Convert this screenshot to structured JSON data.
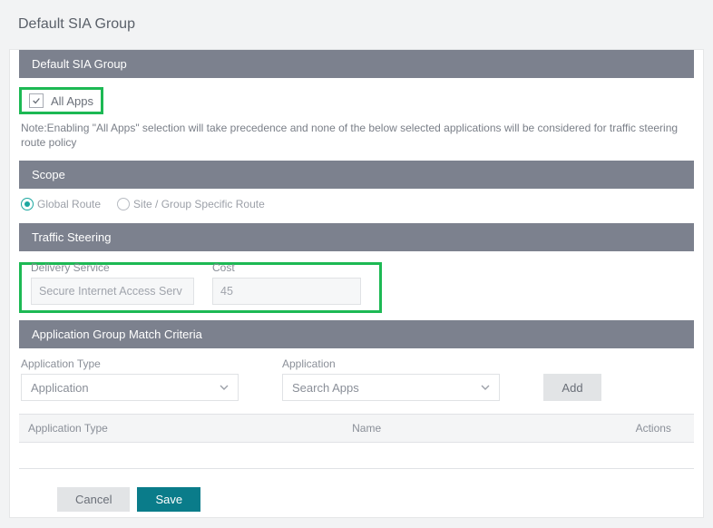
{
  "page_title": "Default SIA Group",
  "bands": {
    "default_sia_group": "Default SIA Group",
    "scope": "Scope",
    "traffic_steering": "Traffic Steering",
    "app_match": "Application Group Match Criteria"
  },
  "all_apps": {
    "label": "All Apps",
    "checked": true
  },
  "note": "Note:Enabling \"All Apps\" selection will take precedence and none of the below selected applications will be considered for traffic steering route policy",
  "scope": {
    "options": [
      {
        "label": "Global Route",
        "selected": true
      },
      {
        "label": "Site / Group Specific Route",
        "selected": false
      }
    ]
  },
  "traffic_steering": {
    "delivery_service": {
      "label": "Delivery Service",
      "value": "Secure Internet Access Serv"
    },
    "cost": {
      "label": "Cost",
      "value": "45"
    }
  },
  "match_criteria": {
    "app_type_label": "Application Type",
    "app_type_value": "Application",
    "app_label": "Application",
    "app_placeholder": "Search Apps",
    "add_label": "Add",
    "columns": [
      "Application Type",
      "Name",
      "Actions"
    ]
  },
  "buttons": {
    "cancel": "Cancel",
    "save": "Save"
  },
  "colors": {
    "highlight": "#1db954",
    "accent": "#0a7c8a"
  }
}
